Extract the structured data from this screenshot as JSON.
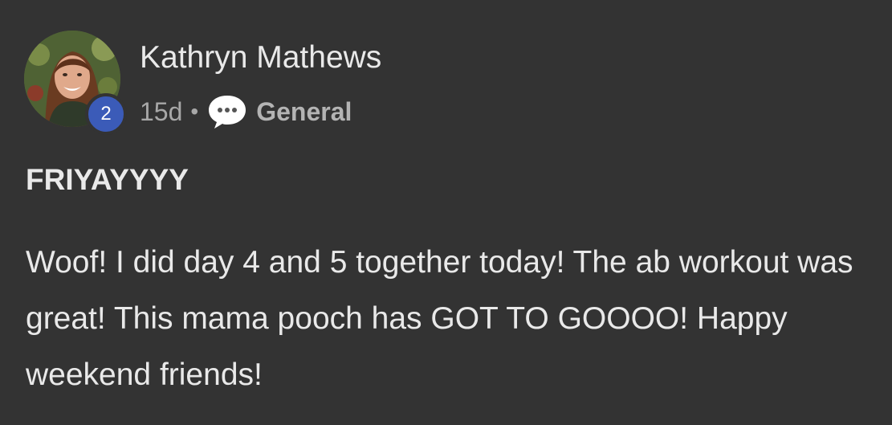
{
  "post": {
    "author": "Kathryn Mathews",
    "badge_count": "2",
    "time": "15d",
    "separator": "•",
    "group": "General",
    "title": "FRIYAYYYY",
    "body": "Woof! I did day 4 and 5 together today! The ab workout was great! This mama pooch has GOT TO GOOOO! Happy weekend friends!"
  },
  "icons": {
    "group_icon": "chat-bubble-icon"
  },
  "colors": {
    "background": "#333333",
    "badge": "#3b5bb8",
    "text": "#e9e9e9",
    "muted": "#a8a8a8"
  }
}
